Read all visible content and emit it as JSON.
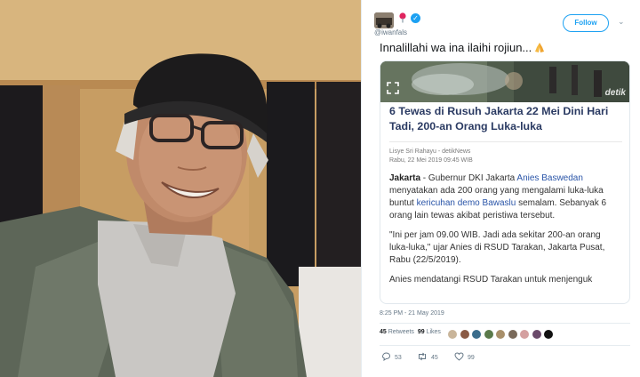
{
  "tweet": {
    "handle": "@iwanfals",
    "follow_label": "Follow",
    "text": "Innalillahi wa ina ilaihi rojiun...",
    "timestamp": "8:25 PM - 21 May 2019",
    "retweets_count": "45",
    "retweets_label": "Retweets",
    "likes_count": "99",
    "likes_label": "Likes",
    "reply_count": "53",
    "retweet_count_action": "45",
    "like_count_action": "99"
  },
  "card": {
    "image_watermark": "detik",
    "headline": "6 Tewas di Rusuh Jakarta 22 Mei Dini Hari Tadi, 200-an Orang Luka-luka",
    "author": "Lisye Sri Rahayu - detikNews",
    "date": "Rabu, 22 Mei 2019 09:45 WIB",
    "p1_loc": "Jakarta",
    "p1_a": " - Gubernur DKI Jakarta ",
    "p1_link1": "Anies Baswedan",
    "p1_b": " menyatakan ada 200 orang yang mengalami luka-luka buntut ",
    "p1_link2": "kericuhan demo Bawaslu",
    "p1_c": " semalam. Sebanyak 6 orang lain tewas akibat peristiwa tersebut.",
    "p2": "\"Ini per jam 09.00 WIB. Jadi ada sekitar 200-an orang luka-luka,\" ujar Anies di RSUD Tarakan, Jakarta Pusat, Rabu (22/5/2019).",
    "p3": "Anies mendatangi RSUD Tarakan untuk menjenguk"
  },
  "colors": {
    "twitter_blue": "#1da1f2",
    "headline": "#2b3b63",
    "link": "#2a55a8"
  },
  "icons": [
    "pin-emoji-icon",
    "verified-badge-icon",
    "chevron-down-icon",
    "praying-hands-icon",
    "expand-icon",
    "reply-icon",
    "retweet-icon",
    "heart-icon"
  ]
}
